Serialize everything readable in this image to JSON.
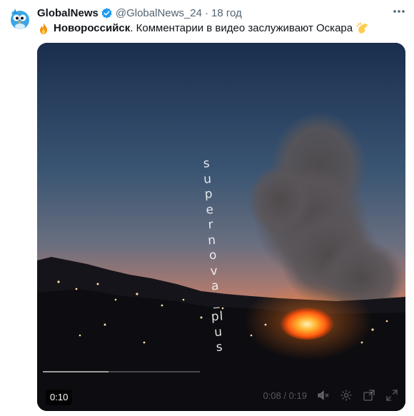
{
  "tweet": {
    "author_name": "GlobalNews",
    "handle": "@GlobalNews_24",
    "separator": "·",
    "time": "18 год",
    "text_bold": "Новороссийск",
    "text_rest": ". Комментарии в видео заслуживают Оскара",
    "icons": {
      "avatar": "blue-bird-logo",
      "verified": "verified-badge-icon",
      "more": "more-options-icon",
      "lead_emoji": "fire-emoji",
      "trail_emoji": "clapping-hands-emoji"
    }
  },
  "video": {
    "watermark": "supernova_plus",
    "elapsed": "0:10",
    "duration_display": "0:08 / 0:19",
    "progress_fraction": 0.42,
    "icons": [
      "volume-icon",
      "settings-icon",
      "popout-icon",
      "fullscreen-icon"
    ]
  },
  "colors": {
    "accent_verified": "#1d9bf0",
    "text_primary": "#0f1419",
    "text_secondary": "#536471",
    "fire": "#ff7a1a"
  }
}
